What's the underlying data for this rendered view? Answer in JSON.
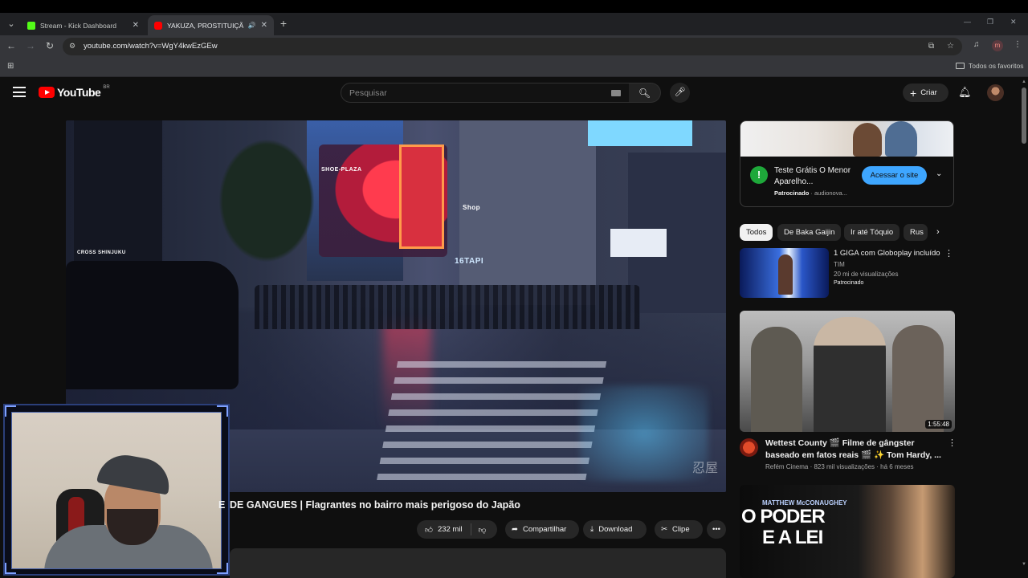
{
  "browser": {
    "tabs": [
      {
        "title": "Stream - Kick Dashboard",
        "favicon_color": "#53fc18"
      },
      {
        "title": "YAKUZA, PROSTITUIÇÃO E G",
        "favicon_color": "#ff0000",
        "active": true
      }
    ],
    "url": "youtube.com/watch?v=WgY4kwEzGEw",
    "bookmarks_all": "Todos os favoritos",
    "profile_initial": "m"
  },
  "youtube": {
    "logo_text": "YouTube",
    "country_code": "BR",
    "search_placeholder": "Pesquisar",
    "create_label": "Criar",
    "accent": "#ff0000"
  },
  "video": {
    "title_prefix": "E",
    "title": "DE GANGUES | Flagrantes no bairro mais perigoso do Japão",
    "sign_cross": "CROSS SHINJUKU",
    "sign_plaza": "SHOE-PLAZA",
    "sign_tapi": "16TAPI",
    "sign_shop": "Shop",
    "watermark": "忍屋",
    "likes": "232 mil",
    "share_label": "Compartilhar",
    "download_label": "Download",
    "clip_label": "Clipe"
  },
  "ad": {
    "title": "Teste Grátis O Menor Aparelho...",
    "sponsored": "Patrocinado",
    "domain": "audionova...",
    "cta": "Acessar o site",
    "logo_letter": "!"
  },
  "chips": [
    "Todos",
    "De Baka Gaijin",
    "Ir até Tóquio",
    "Rus"
  ],
  "recommendations": [
    {
      "title": "1 GIGA com Globoplay incluído",
      "channel": "TIM",
      "views": "20 mi de visualizações",
      "badge": "Patrocinado"
    },
    {
      "title_line1": "Wettest County 🎬 Filme de gângster",
      "title_line2": "baseado em fatos reais 🎬 ✨ Tom Hardy, ...",
      "channel": "Refém Cinema",
      "meta": "823 mil visualizações · há 6 meses",
      "duration": "1:55:48"
    },
    {
      "thumb_top": "MATTHEW McCONAUGHEY",
      "thumb_title_line1": "O PODER",
      "thumb_title_line2": "E A LEI"
    }
  ]
}
